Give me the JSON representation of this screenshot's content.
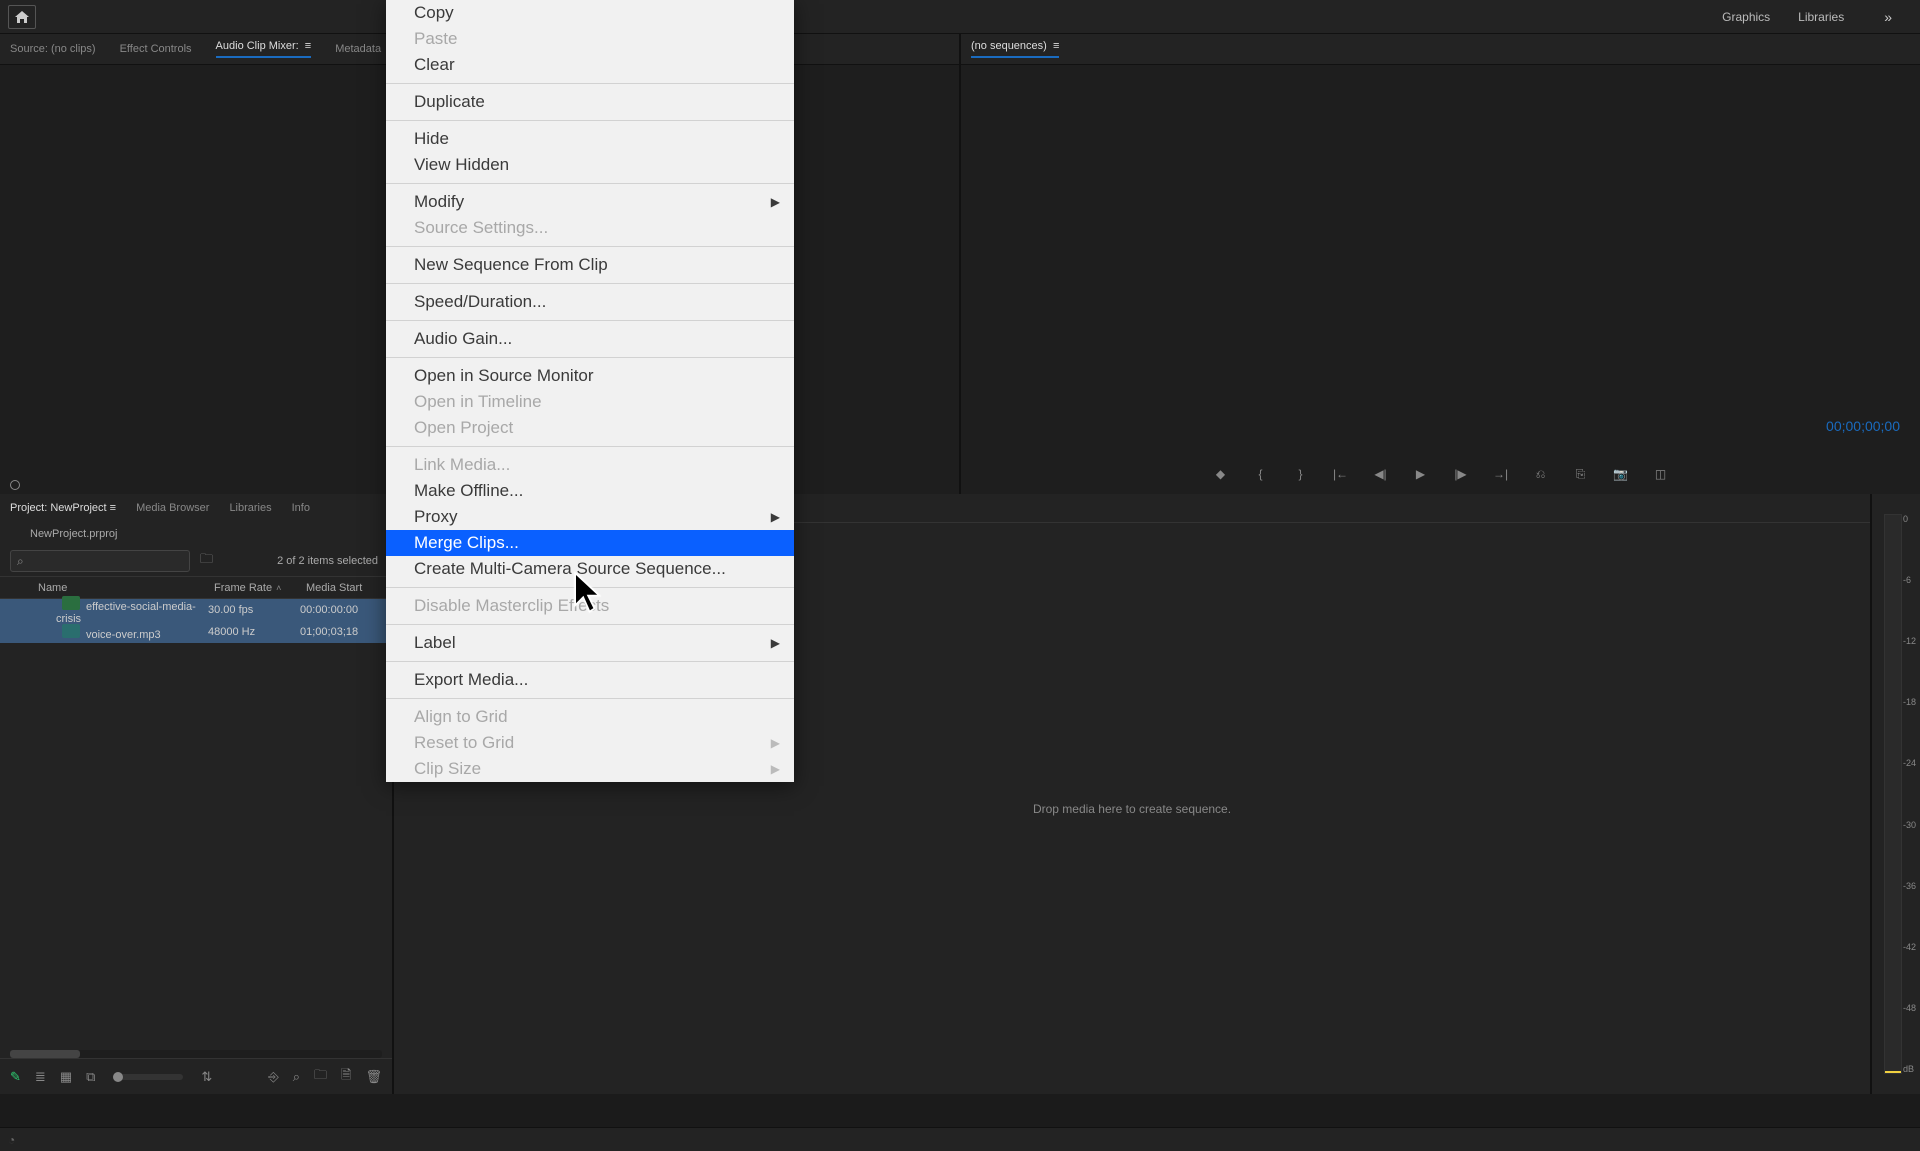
{
  "toolbar": {
    "workspace_tabs": [
      "Graphics",
      "Libraries"
    ]
  },
  "source_panel": {
    "tabs": [
      "Source: (no clips)",
      "Effect Controls",
      "Audio Clip Mixer:",
      "Metadata"
    ],
    "active_tab_index": 2
  },
  "program_panel": {
    "tab": "(no sequences)",
    "timecode": "00;00;00;00"
  },
  "project_panel": {
    "tabs": [
      "Project: NewProject",
      "Media Browser",
      "Libraries",
      "Info"
    ],
    "file": "NewProject.prproj",
    "selection_text": "2 of 2 items selected",
    "columns": {
      "name": "Name",
      "frame_rate": "Frame Rate",
      "media_start": "Media Start"
    },
    "clips": [
      {
        "label_color": "blue",
        "icon": "video",
        "name": "effective-social-media-crisis",
        "frame_rate": "30.00 fps",
        "media_start": "00:00:00:00"
      },
      {
        "label_color": "green",
        "icon": "audio",
        "name": "voice-over.mp3",
        "frame_rate": "48000 Hz",
        "media_start": "01;00;03;18"
      }
    ]
  },
  "timeline": {
    "drop_hint": "Drop media here to create sequence."
  },
  "meters": {
    "ticks": [
      "0",
      "-6",
      "-12",
      "-18",
      "-24",
      "-30",
      "-36",
      "-42",
      "-48",
      "dB"
    ]
  },
  "context_menu": {
    "items": [
      {
        "label": "Copy",
        "enabled": true
      },
      {
        "label": "Paste",
        "enabled": false
      },
      {
        "label": "Clear",
        "enabled": true
      },
      {
        "divider": true
      },
      {
        "label": "Duplicate",
        "enabled": true
      },
      {
        "divider": true
      },
      {
        "label": "Hide",
        "enabled": true
      },
      {
        "label": "View Hidden",
        "enabled": true
      },
      {
        "divider": true
      },
      {
        "label": "Modify",
        "enabled": true,
        "submenu": true
      },
      {
        "label": "Source Settings...",
        "enabled": false
      },
      {
        "divider": true
      },
      {
        "label": "New Sequence From Clip",
        "enabled": true
      },
      {
        "divider": true
      },
      {
        "label": "Speed/Duration...",
        "enabled": true
      },
      {
        "divider": true
      },
      {
        "label": "Audio Gain...",
        "enabled": true
      },
      {
        "divider": true
      },
      {
        "label": "Open in Source Monitor",
        "enabled": true
      },
      {
        "label": "Open in Timeline",
        "enabled": false
      },
      {
        "label": "Open Project",
        "enabled": false
      },
      {
        "divider": true
      },
      {
        "label": "Link Media...",
        "enabled": false
      },
      {
        "label": "Make Offline...",
        "enabled": true
      },
      {
        "label": "Proxy",
        "enabled": true,
        "submenu": true
      },
      {
        "label": "Merge Clips...",
        "enabled": true,
        "highlight": true
      },
      {
        "label": "Create Multi-Camera Source Sequence...",
        "enabled": true
      },
      {
        "divider": true
      },
      {
        "label": "Disable Masterclip Effects",
        "enabled": false
      },
      {
        "divider": true
      },
      {
        "label": "Label",
        "enabled": true,
        "submenu": true
      },
      {
        "divider": true
      },
      {
        "label": "Export Media...",
        "enabled": true
      },
      {
        "divider": true
      },
      {
        "label": "Align to Grid",
        "enabled": false
      },
      {
        "label": "Reset to Grid",
        "enabled": false,
        "submenu": true
      },
      {
        "label": "Clip Size",
        "enabled": false,
        "submenu": true
      }
    ]
  }
}
